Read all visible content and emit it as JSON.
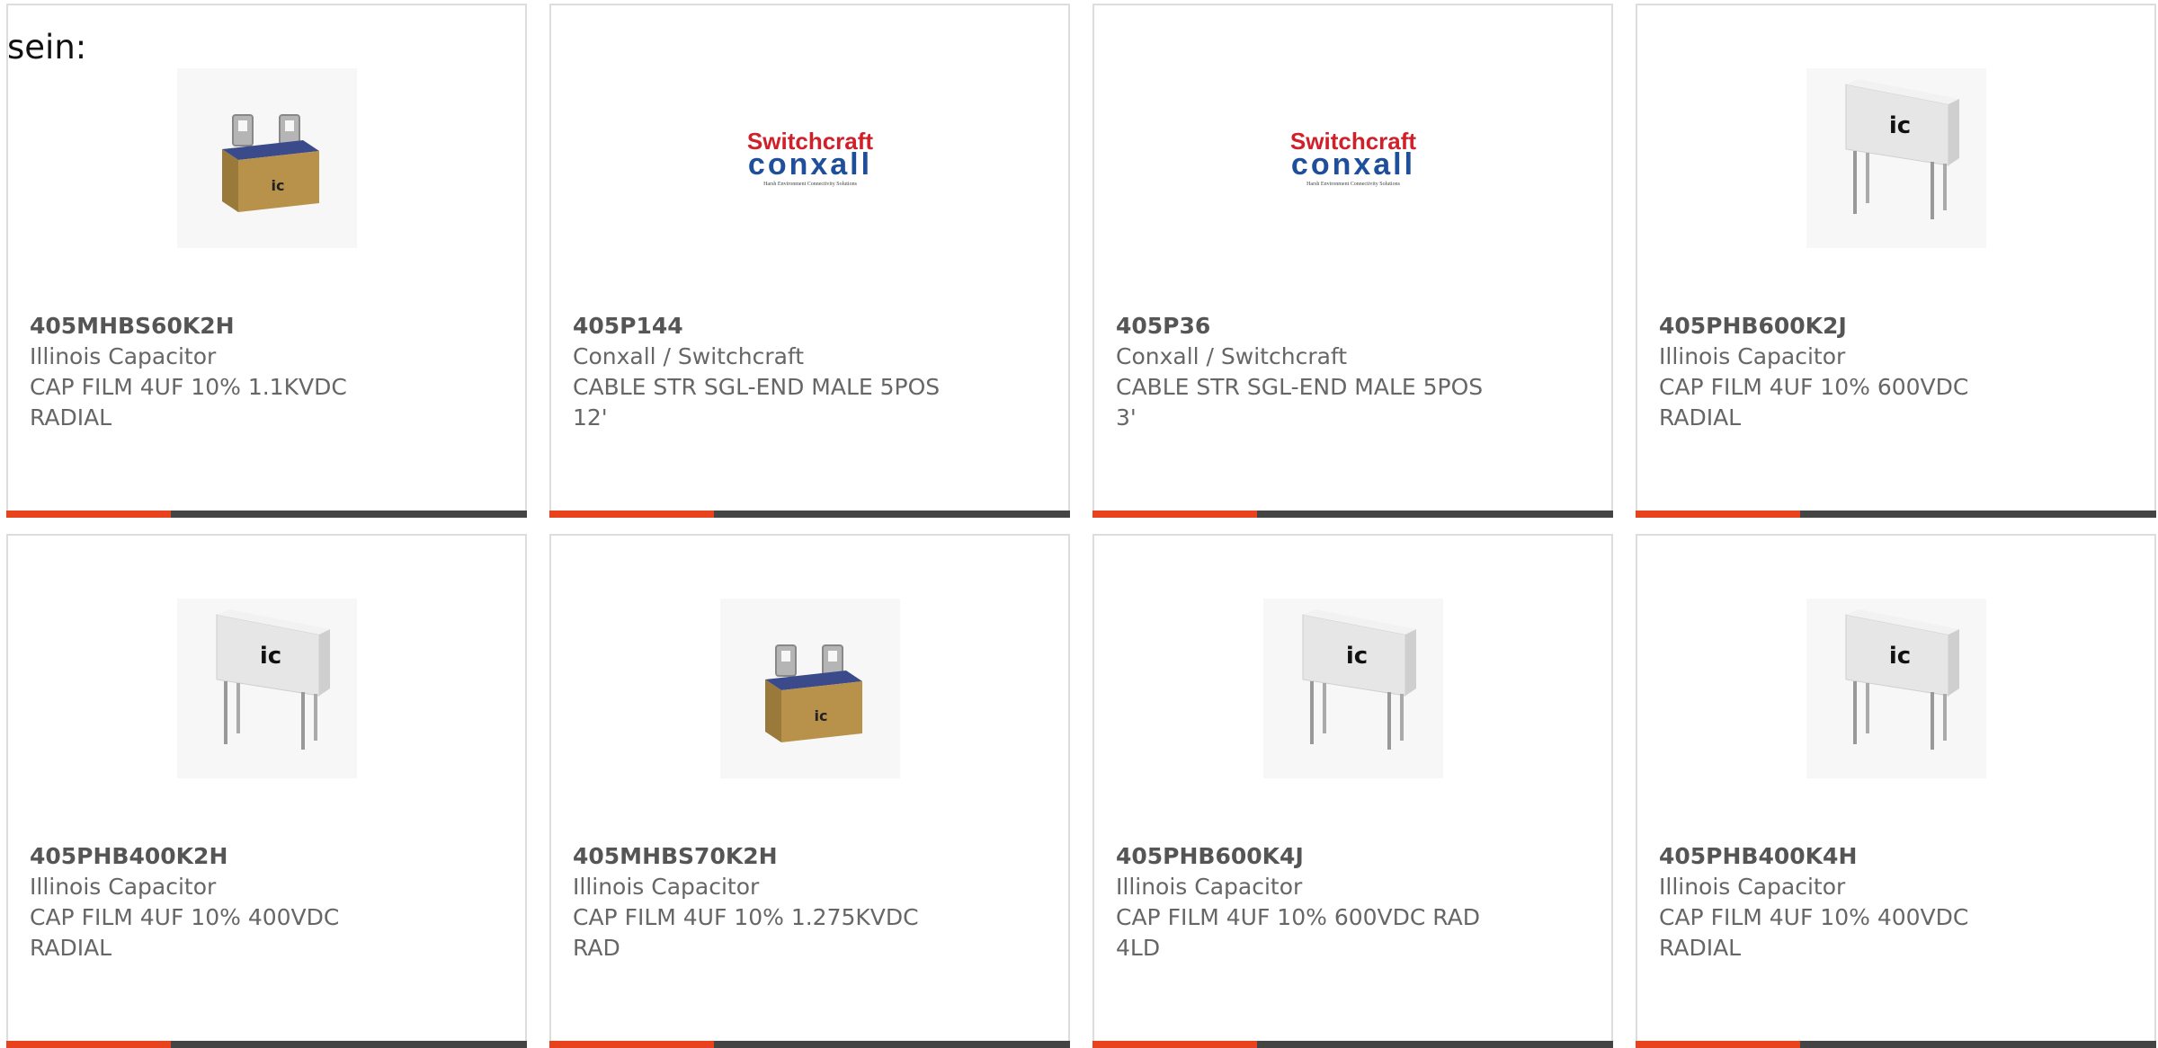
{
  "lead_text": "sein:",
  "colors": {
    "accent": "#e8431c",
    "bar": "#444444",
    "border": "#dddddd",
    "text": "#666666"
  },
  "logo": {
    "line1": "Switchcraft",
    "line2": "conxall",
    "tagline": "Harsh Environment Connectivity Solutions"
  },
  "products": [
    {
      "part_number": "405MHBS60K2H",
      "manufacturer": "Illinois Capacitor",
      "description": "CAP FILM 4UF 10% 1.1KVDC RADIAL",
      "image": "box-capacitor"
    },
    {
      "part_number": "405P144",
      "manufacturer": "Conxall / Switchcraft",
      "description": "CABLE STR SGL-END MALE 5POS 12'",
      "image": "switchcraft-logo"
    },
    {
      "part_number": "405P36",
      "manufacturer": "Conxall / Switchcraft",
      "description": "CABLE STR SGL-END MALE 5POS 3'",
      "image": "switchcraft-logo"
    },
    {
      "part_number": "405PHB600K2J",
      "manufacturer": "Illinois Capacitor",
      "description": "CAP FILM 4UF 10% 600VDC RADIAL",
      "image": "film-capacitor"
    },
    {
      "part_number": "405PHB400K2H",
      "manufacturer": "Illinois Capacitor",
      "description": "CAP FILM 4UF 10% 400VDC RADIAL",
      "image": "film-capacitor"
    },
    {
      "part_number": "405MHBS70K2H",
      "manufacturer": "Illinois Capacitor",
      "description": "CAP FILM 4UF 10% 1.275KVDC RAD",
      "image": "box-capacitor"
    },
    {
      "part_number": "405PHB600K4J",
      "manufacturer": "Illinois Capacitor",
      "description": "CAP FILM 4UF 10% 600VDC RAD 4LD",
      "image": "film-capacitor"
    },
    {
      "part_number": "405PHB400K4H",
      "manufacturer": "Illinois Capacitor",
      "description": "CAP FILM 4UF 10% 400VDC RADIAL",
      "image": "film-capacitor"
    }
  ]
}
